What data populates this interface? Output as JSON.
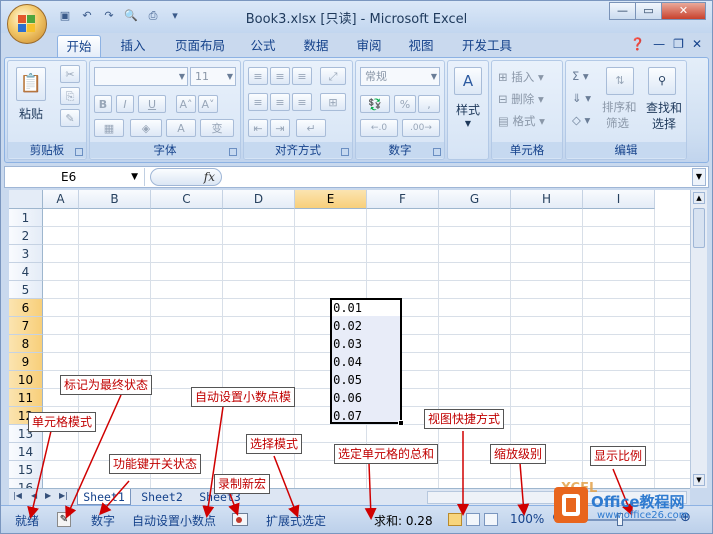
{
  "window": {
    "title": "Book3.xlsx [只读] - Microsoft Excel",
    "controls": [
      "—",
      "▭",
      "✕"
    ]
  },
  "tabs": [
    "开始",
    "插入",
    "页面布局",
    "公式",
    "数据",
    "审阅",
    "视图",
    "开发工具"
  ],
  "ribbon": {
    "clipboard": {
      "label": "剪贴板",
      "paste": "粘贴"
    },
    "font": {
      "label": "字体",
      "font_size": "11",
      "bold": "B",
      "italic": "I",
      "underline": "U"
    },
    "alignment": {
      "label": "对齐方式"
    },
    "number": {
      "label": "数字",
      "format": "常规",
      "percent": "%",
      "comma": ","
    },
    "styles": {
      "label": "样式"
    },
    "cells": {
      "label": "单元格",
      "insert": "插入",
      "delete": "删除",
      "format": "格式"
    },
    "editing": {
      "label": "编辑",
      "sort_filter_1": "排序和",
      "sort_filter_2": "筛选",
      "find_select_1": "查找和",
      "find_select_2": "选择"
    }
  },
  "formula_bar": {
    "name_box": "E6",
    "fx": "fx",
    "formula": ""
  },
  "columns": [
    "A",
    "B",
    "C",
    "D",
    "E",
    "F",
    "G",
    "H",
    "I"
  ],
  "rows": [
    "1",
    "2",
    "3",
    "4",
    "5",
    "6",
    "7",
    "8",
    "9",
    "10",
    "11",
    "12",
    "13",
    "14",
    "15",
    "16"
  ],
  "cells": {
    "E6": "0.01",
    "E7": "0.02",
    "E8": "0.03",
    "E9": "0.04",
    "E10": "0.05",
    "E11": "0.06",
    "E12": "0.07"
  },
  "sheets": [
    "Sheet1",
    "Sheet2",
    "Sheet3"
  ],
  "status_bar": {
    "mode": "就绪",
    "num_lock": "数字",
    "fixed_decimal": "自动设置小数点",
    "extend_selection": "扩展式选定",
    "sum": "求和: 0.28",
    "zoom": "100%"
  },
  "annotations": {
    "cell_mode": "单元格模式",
    "mark_final": "标记为最终状态",
    "key_toggle": "功能键开关状态",
    "fixed_decimal_mode": "自动设置小数点模",
    "record_macro": "录制新宏",
    "selection_mode": "选择模式",
    "sum_selected": "选定单元格的总和",
    "view_shortcuts": "视图快捷方式",
    "zoom_level": "缩放级别",
    "zoom_ratio": "显示比例"
  },
  "watermark": {
    "brand": "Office教程网",
    "url": "www.office26.com",
    "overlay": "XCEL"
  },
  "accent_colors": {
    "annotation_text": "#c00000",
    "selection_border": "#000000",
    "header_highlight": "#f8cf7a"
  }
}
